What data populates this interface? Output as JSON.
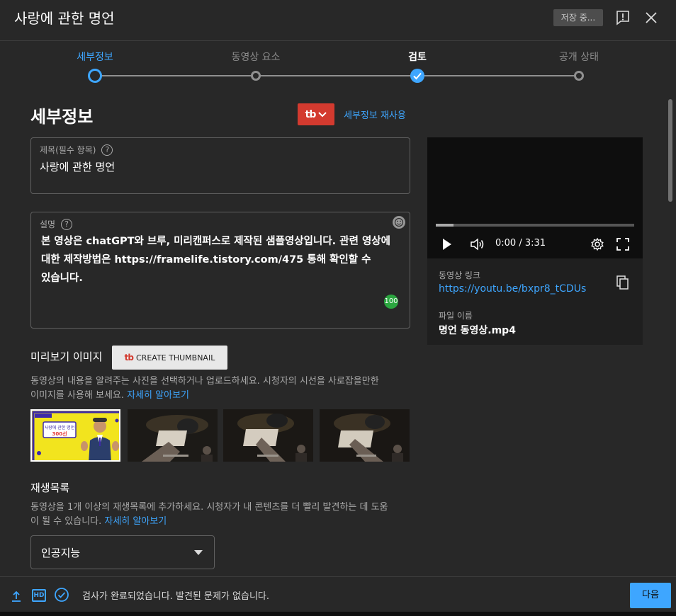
{
  "header": {
    "title": "사랑에 관한 명언",
    "saving_label": "저장 중...",
    "icons": [
      "feedback-icon",
      "close-icon"
    ]
  },
  "stepper": {
    "steps": [
      {
        "label": "세부정보",
        "state": "active"
      },
      {
        "label": "동영상 요소",
        "state": "pending"
      },
      {
        "label": "검토",
        "state": "done"
      },
      {
        "label": "공개 상태",
        "state": "pending"
      }
    ]
  },
  "details": {
    "heading": "세부정보",
    "tubebuddy_logo": "tb",
    "reuse_link": "세부정보 재사용",
    "title_field": {
      "label": "제목(필수 항목)",
      "value": "사랑에 관한 명언"
    },
    "description_field": {
      "label": "설명",
      "value": "본 영상은 chatGPT와 브루, 미리캔퍼스로 제작된 샘플영상입니다.  관련 영상에 대한 제작방법은 https://framelife.tistory.com/475 통해 확인할 수 있습니다.",
      "score": "100"
    }
  },
  "thumbnail": {
    "title": "미리보기 이미지",
    "create_button": "CREATE THUMBNAIL",
    "help_text_1": "동영상의 내용을 알려주는 사진을 선택하거나 업로드하세요. 시청자의 시선을 사로잡을만한",
    "help_text_2": "이미지를 사용해 보세요.",
    "learn_more": "자세히 알아보기",
    "selected_index": 0,
    "items": [
      {
        "kind": "custom",
        "text_line_1": "사랑에 관한 명언",
        "text_line_2": "300선"
      },
      {
        "kind": "auto",
        "caption": ""
      },
      {
        "kind": "auto",
        "caption": ""
      },
      {
        "kind": "auto",
        "caption": ""
      }
    ]
  },
  "playlist": {
    "title": "재생목록",
    "help_text_1": "동영상을 1개 이상의 재생목록에 추가하세요. 시청자가 내 콘텐츠를 더 빨리 발견하는 데 도움",
    "help_text_2": "이 될 수 있습니다.",
    "learn_more": "자세히 알아보기",
    "selected": "인공지능"
  },
  "preview": {
    "time": "0:00 / 3:31",
    "progress": 0.09,
    "link_label": "동영상 링크",
    "link": "https://youtu.be/bxpr8_tCDUs",
    "file_label": "파일 이름",
    "file_name": "명언 동영상.mp4"
  },
  "footer": {
    "status": "검사가 완료되었습니다. 발견된 문제가 없습니다.",
    "icons": [
      "upload-icon",
      "hd-icon",
      "check-circle-icon"
    ],
    "hd_label": "HD",
    "next": "다음"
  },
  "colors": {
    "background": "#282828",
    "accent": "#3ea6ff",
    "tubebuddy": "#d33a2f",
    "score_green": "#2ba640"
  }
}
